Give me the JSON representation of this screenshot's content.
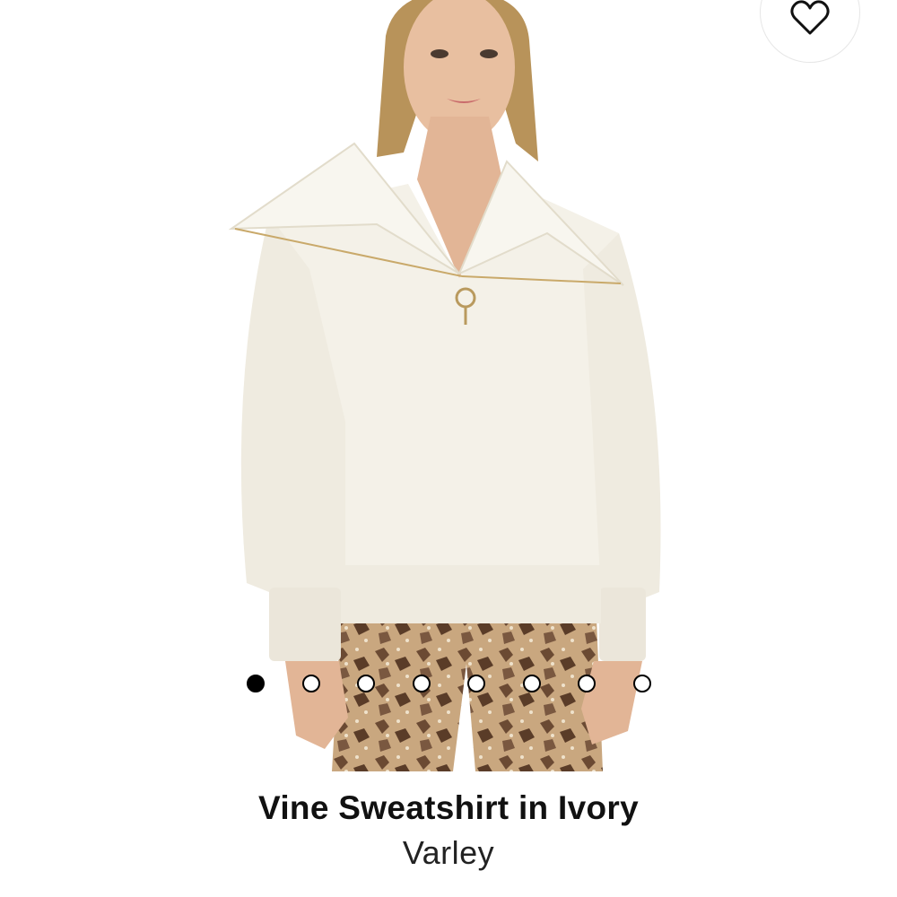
{
  "product": {
    "title": "Vine Sweatshirt in Ivory",
    "brand": "Varley"
  },
  "gallery": {
    "image_count": 8,
    "active_index": 0
  },
  "icons": {
    "wishlist": "heart-icon"
  },
  "colors": {
    "sweatshirt": "#f4f1e8",
    "dot_active": "#000000",
    "dot_inactive": "#ffffff",
    "text": "#111111"
  }
}
